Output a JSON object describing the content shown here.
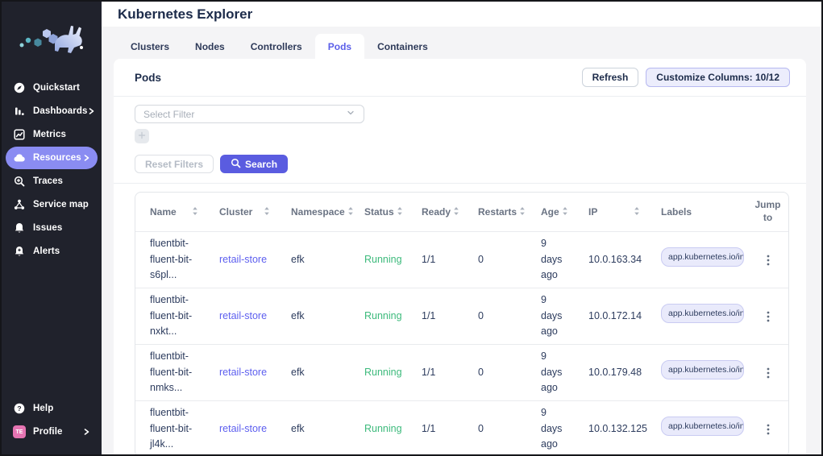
{
  "header": {
    "title": "Kubernetes Explorer"
  },
  "sidebar": {
    "items": [
      {
        "label": "Quickstart",
        "icon": "compass-icon"
      },
      {
        "label": "Dashboards",
        "icon": "bar-chart-icon",
        "has_submenu": true
      },
      {
        "label": "Metrics",
        "icon": "line-chart-icon"
      },
      {
        "label": "Resources",
        "icon": "cloud-icon",
        "has_submenu": true,
        "active": true
      },
      {
        "label": "Traces",
        "icon": "trace-search-icon"
      },
      {
        "label": "Service map",
        "icon": "service-map-icon"
      },
      {
        "label": "Issues",
        "icon": "bell-icon"
      },
      {
        "label": "Alerts",
        "icon": "bell-plus-icon"
      }
    ],
    "footer_items": [
      {
        "label": "Help",
        "icon": "help-icon"
      },
      {
        "label": "Profile",
        "icon": "avatar",
        "avatar_initials": "TE",
        "has_submenu": true
      }
    ]
  },
  "tabs": {
    "items": [
      {
        "label": "Clusters",
        "active": false
      },
      {
        "label": "Nodes",
        "active": false
      },
      {
        "label": "Controllers",
        "active": false
      },
      {
        "label": "Pods",
        "active": true
      },
      {
        "label": "Containers",
        "active": false
      }
    ]
  },
  "panel": {
    "title": "Pods",
    "buttons": {
      "refresh": "Refresh",
      "customize_columns": "Customize Columns: 10/12"
    },
    "filters": {
      "select_placeholder": "Select Filter",
      "reset": "Reset Filters",
      "search": "Search"
    }
  },
  "table": {
    "columns": [
      {
        "label": "Name",
        "sortable": true
      },
      {
        "label": "Cluster",
        "sortable": true
      },
      {
        "label": "Namespace",
        "sortable": true
      },
      {
        "label": "Status",
        "sortable": true
      },
      {
        "label": "Ready",
        "sortable": true
      },
      {
        "label": "Restarts",
        "sortable": true
      },
      {
        "label": "Age",
        "sortable": true
      },
      {
        "label": "IP",
        "sortable": true
      },
      {
        "label": "Labels",
        "sortable": false
      },
      {
        "label": "Jump to",
        "sortable": false
      }
    ],
    "rows": [
      {
        "name": "fluentbit-fluent-bit-s6pl...",
        "cluster": "retail-store",
        "namespace": "efk",
        "status": "Running",
        "ready": "1/1",
        "restarts": "0",
        "age": "9 days ago",
        "ip": "10.0.163.34",
        "labels": "app.kubernetes.io/instan"
      },
      {
        "name": "fluentbit-fluent-bit-nxkt...",
        "cluster": "retail-store",
        "namespace": "efk",
        "status": "Running",
        "ready": "1/1",
        "restarts": "0",
        "age": "9 days ago",
        "ip": "10.0.172.14",
        "labels": "app.kubernetes.io/instan"
      },
      {
        "name": "fluentbit-fluent-bit-nmks...",
        "cluster": "retail-store",
        "namespace": "efk",
        "status": "Running",
        "ready": "1/1",
        "restarts": "0",
        "age": "9 days ago",
        "ip": "10.0.179.48",
        "labels": "app.kubernetes.io/instan"
      },
      {
        "name": "fluentbit-fluent-bit-jl4k...",
        "cluster": "retail-store",
        "namespace": "efk",
        "status": "Running",
        "ready": "1/1",
        "restarts": "0",
        "age": "9 days ago",
        "ip": "10.0.132.125",
        "labels": "app.kubernetes.io/instan"
      }
    ]
  },
  "icons": {
    "sort": "sort-arrows-icon",
    "select_chevron": "chevron-down-icon",
    "search": "search-icon",
    "add_filter": "plus-icon",
    "row_menu": "kebab-menu-icon",
    "submenu": "chevron-right-icon"
  },
  "colors": {
    "accent_purple": "#5d5fef",
    "sidebar_active_pill": "#8a8cf2",
    "search_button": "#5a5ce0",
    "status_running_green": "#3dba7c",
    "sidebar_background": "#20222c",
    "avatar_pink": "#e574b2",
    "label_chip_background": "#e9eafb"
  }
}
